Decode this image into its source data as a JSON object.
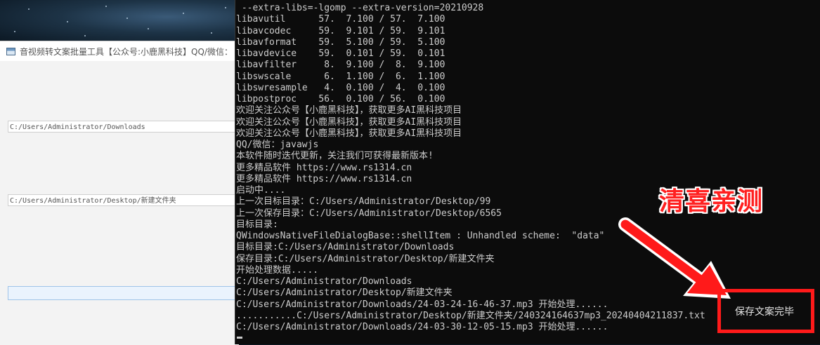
{
  "gui_window": {
    "title": "音视频转文案批量工具【公众号:小鹿黑科技】QQ/微信：",
    "source_dir": "C:/Users/Administrator/Downloads",
    "save_dir": "C:/Users/Administrator/Desktop/新建文件夹",
    "progress_value": ""
  },
  "console": {
    "lines": [
      " --extra-libs=-lgomp --extra-version=20210928",
      "libavutil      57.  7.100 / 57.  7.100",
      "libavcodec     59.  9.101 / 59.  9.101",
      "libavformat    59.  5.100 / 59.  5.100",
      "libavdevice    59.  0.101 / 59.  0.101",
      "libavfilter     8.  9.100 /  8.  9.100",
      "libswscale      6.  1.100 /  6.  1.100",
      "libswresample   4.  0.100 /  4.  0.100",
      "libpostproc    56.  0.100 / 56.  0.100",
      "欢迎关注公众号【小鹿黑科技】，获取更多AI黑科技项目",
      "欢迎关注公众号【小鹿黑科技】，获取更多AI黑科技项目",
      "欢迎关注公众号【小鹿黑科技】，获取更多AI黑科技项目",
      "QQ/微信：javawjs",
      "本软件随时迭代更新，关注我们可获得最新版本!",
      "更多精品软件 https://www.rs1314.cn",
      "更多精品软件 https://www.rs1314.cn",
      "启动中....",
      "上一次目标目录：C:/Users/Administrator/Desktop/99",
      "上一次保存目录：C:/Users/Administrator/Desktop/6565",
      "目标目录:",
      "QWindowsNativeFileDialogBase::shellItem : Unhandled scheme:  \"data\"",
      "目标目录:C:/Users/Administrator/Downloads",
      "保存目录:C:/Users/Administrator/Desktop/新建文件夹",
      "开始处理数据.....",
      "C:/Users/Administrator/Downloads",
      "C:/Users/Administrator/Desktop/新建文件夹",
      "C:/Users/Administrator/Downloads/24-03-24-16-46-37.mp3 开始处理......",
      "...........C:/Users/Administrator/Desktop/新建文件夹/240324164637mp3_20240404211837.txt",
      "C:/Users/Administrator/Downloads/24-03-30-12-05-15.mp3 开始处理......"
    ]
  },
  "annotation": {
    "title": "清喜亲测",
    "highlight_text": "保存文案完毕",
    "color": "#ff1a1a"
  },
  "icons": {
    "window_icon": "app-window-icon",
    "arrow": "red-arrow-icon"
  }
}
